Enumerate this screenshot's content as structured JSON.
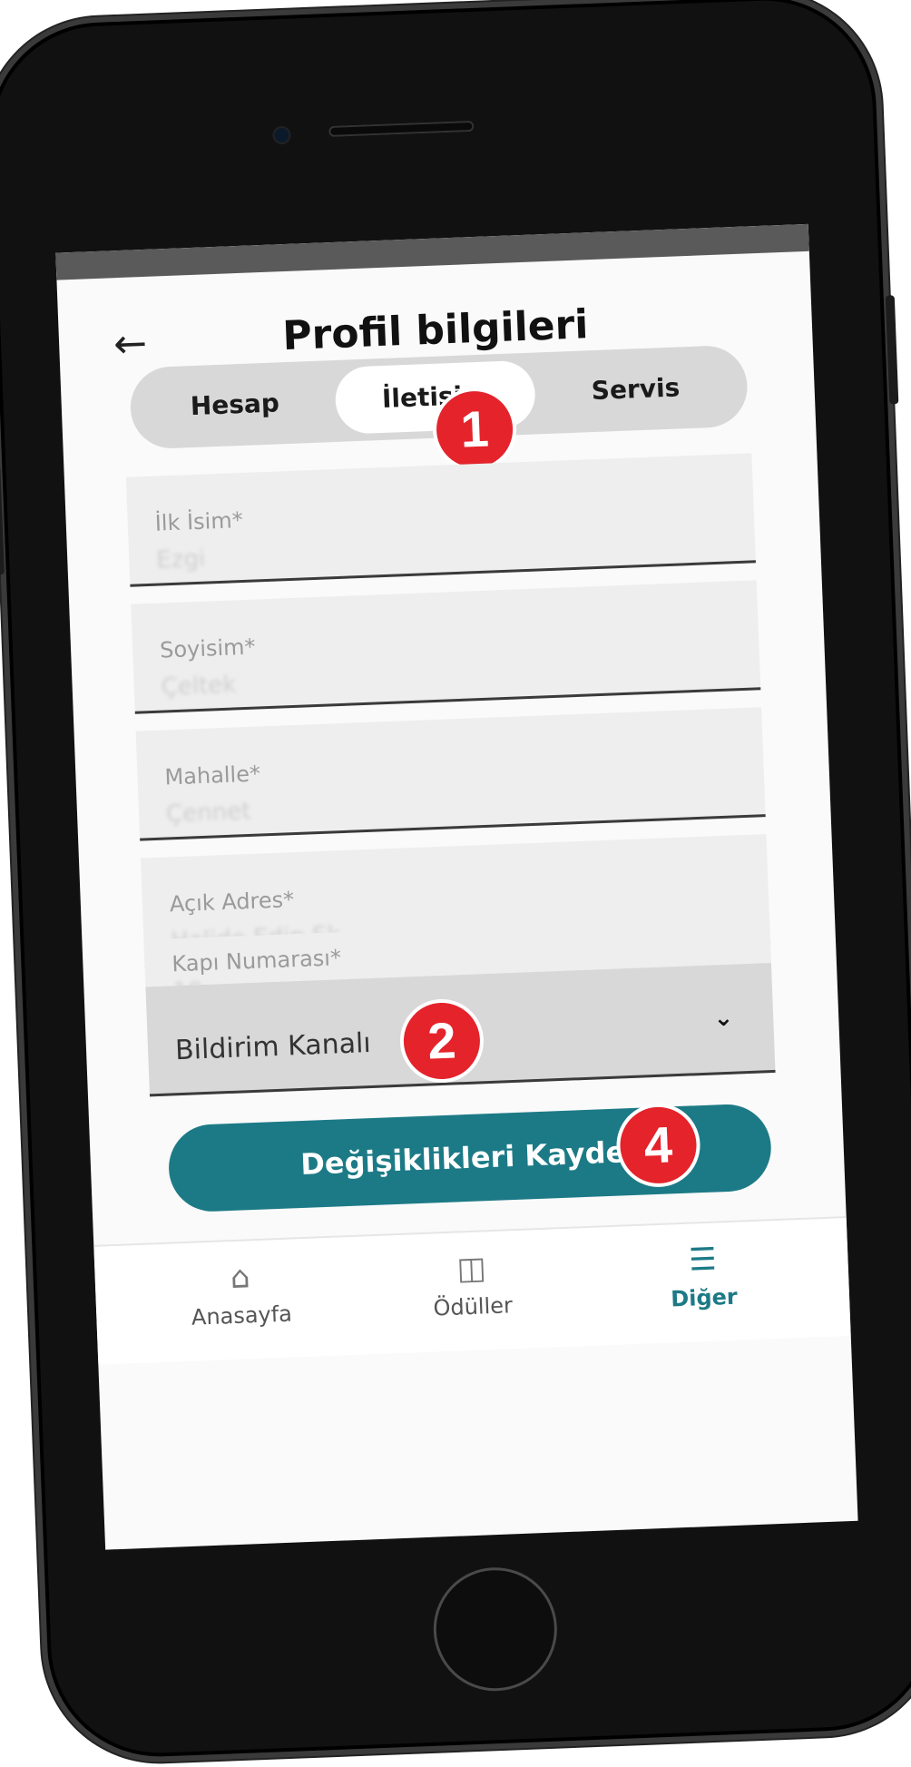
{
  "header": {
    "title": "Profil bilgileri",
    "back_icon": "arrow-left-icon"
  },
  "tabs": [
    {
      "label": "Hesap",
      "active": false
    },
    {
      "label": "İletişim",
      "active": true
    },
    {
      "label": "Servis",
      "active": false
    }
  ],
  "fields": [
    {
      "label": "İlk İsim*",
      "value": "Ezgi"
    },
    {
      "label": "Soyisim*",
      "value": "Çeltek"
    },
    {
      "label": "Mahalle*",
      "value": "Çennet"
    },
    {
      "label": "Açık Adres*",
      "value": "Halide Edip Sk."
    },
    {
      "label": "Kapı Numarası*",
      "value": "10"
    }
  ],
  "select": {
    "label": "Bildirim Kanalı",
    "icon": "chevron-down-icon"
  },
  "save_button": {
    "label": "Değişiklikleri Kaydet"
  },
  "badges": {
    "b1": "1",
    "b2": "2",
    "b4": "4"
  },
  "nav": [
    {
      "label": "Anasayfa",
      "icon": "home-icon",
      "active": false
    },
    {
      "label": "Ödüller",
      "icon": "gift-icon",
      "active": false
    },
    {
      "label": "Diğer",
      "icon": "menu-icon",
      "active": true
    }
  ],
  "colors": {
    "accent": "#1c7a86",
    "badge": "#e4232b"
  }
}
